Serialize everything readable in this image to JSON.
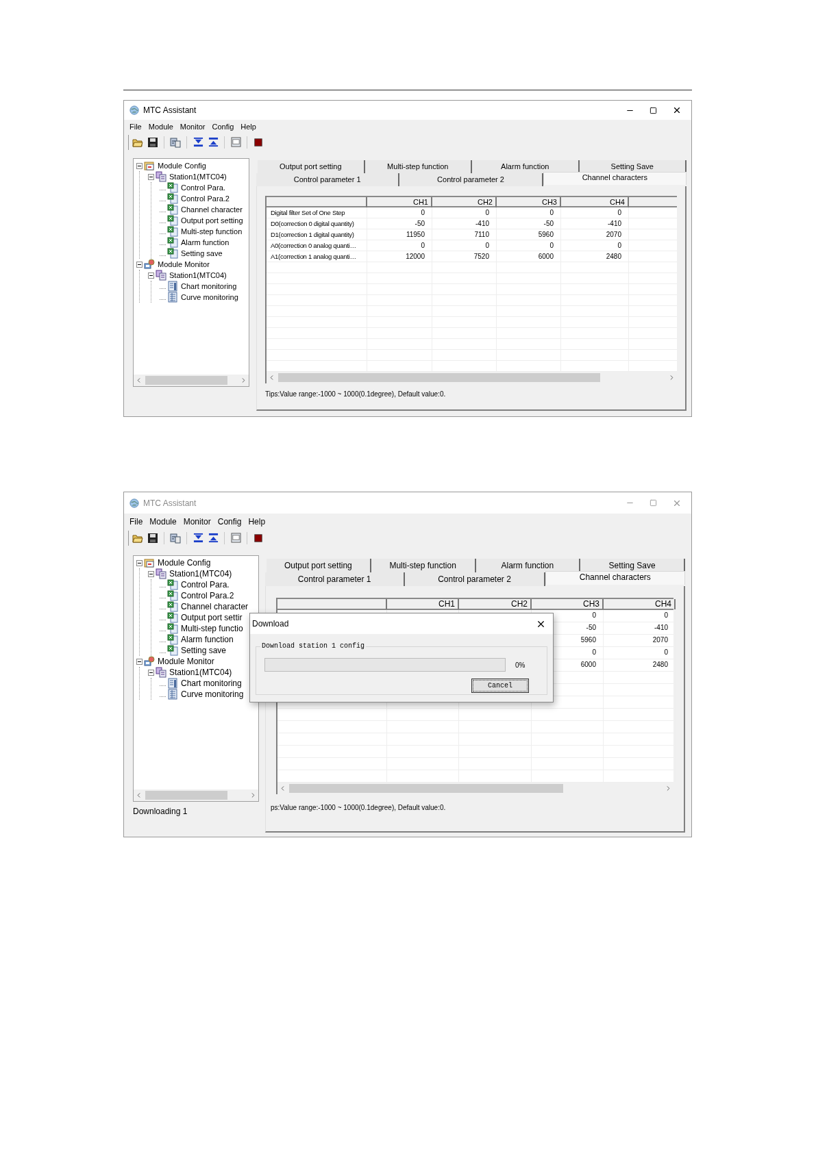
{
  "windows": [
    {
      "title": "MTC Assistant",
      "active": true,
      "menu": [
        "File",
        "Module",
        "Monitor",
        "Config",
        "Help"
      ],
      "tree": [
        {
          "label": "Module Config",
          "kind": "config",
          "expanded": true,
          "children": [
            {
              "label": "Station1(MTC04)",
              "kind": "station",
              "expanded": true,
              "children": [
                {
                  "label": "Control Para.",
                  "kind": "sheet"
                },
                {
                  "label": "Control Para.2",
                  "kind": "sheet"
                },
                {
                  "label": "Channel character",
                  "kind": "sheet"
                },
                {
                  "label": "Output port setting",
                  "kind": "sheet"
                },
                {
                  "label": "Multi-step function",
                  "kind": "sheet"
                },
                {
                  "label": "Alarm function",
                  "kind": "sheet"
                },
                {
                  "label": "Setting save",
                  "kind": "sheet"
                }
              ]
            }
          ]
        },
        {
          "label": "Module Monitor",
          "kind": "monitor",
          "expanded": true,
          "children": [
            {
              "label": "Station1(MTC04)",
              "kind": "station",
              "expanded": true,
              "children": [
                {
                  "label": "Chart monitoring",
                  "kind": "chart"
                },
                {
                  "label": "Curve monitoring",
                  "kind": "curve"
                }
              ]
            }
          ]
        }
      ],
      "tab_rows": [
        {
          "tabs": [
            {
              "label": "Output port setting",
              "selected": false
            },
            {
              "label": "Multi-step function",
              "selected": false
            },
            {
              "label": "Alarm function",
              "selected": false
            },
            {
              "label": "Setting Save",
              "selected": false
            }
          ]
        },
        {
          "tabs": [
            {
              "label": "Control parameter 1",
              "selected": false
            },
            {
              "label": "Control parameter 2",
              "selected": false
            },
            {
              "label": "Channel characters",
              "selected": true
            }
          ]
        }
      ],
      "table": {
        "columns": [
          "CH1",
          "CH2",
          "CH3",
          "CH4"
        ],
        "rows": [
          {
            "label": "Digital filter Set of One Step",
            "ch1": "0",
            "ch2": "0",
            "ch3": "0",
            "ch4": "0"
          },
          {
            "label": "D0(correction 0 digital quantity)",
            "ch1": "-50",
            "ch2": "-410",
            "ch3": "-50",
            "ch4": "-410"
          },
          {
            "label": "D1(correction 1 digital quantity)",
            "ch1": "11950",
            "ch2": "7110",
            "ch3": "5960",
            "ch4": "2070"
          },
          {
            "label": "A0(correction 0 analog quanti…",
            "ch1": "0",
            "ch2": "0",
            "ch3": "0",
            "ch4": "0"
          },
          {
            "label": "A1(correction 1 analog quanti…",
            "ch1": "12000",
            "ch2": "7520",
            "ch3": "6000",
            "ch4": "2480"
          }
        ]
      },
      "tips": "Tips:Value range:-1000 ~ 1000(0.1degree), Default value:0."
    },
    {
      "title": "MTC Assistant",
      "active": false,
      "menu": [
        "File",
        "Module",
        "Monitor",
        "Config",
        "Help"
      ],
      "tree": [
        {
          "label": "Module Config",
          "kind": "config",
          "expanded": true,
          "children": [
            {
              "label": "Station1(MTC04)",
              "kind": "station",
              "expanded": true,
              "children": [
                {
                  "label": "Control Para.",
                  "kind": "sheet"
                },
                {
                  "label": "Control Para.2",
                  "kind": "sheet"
                },
                {
                  "label": "Channel character",
                  "kind": "sheet"
                },
                {
                  "label": "Output port settir",
                  "kind": "sheet"
                },
                {
                  "label": "Multi-step functio",
                  "kind": "sheet"
                },
                {
                  "label": "Alarm function",
                  "kind": "sheet"
                },
                {
                  "label": "Setting save",
                  "kind": "sheet"
                }
              ]
            }
          ]
        },
        {
          "label": "Module Monitor",
          "kind": "monitor",
          "expanded": true,
          "children": [
            {
              "label": "Station1(MTC04)",
              "kind": "station",
              "expanded": true,
              "children": [
                {
                  "label": "Chart monitoring",
                  "kind": "chart"
                },
                {
                  "label": "Curve monitoring",
                  "kind": "curve"
                }
              ]
            }
          ]
        }
      ],
      "status": "Downloading 1",
      "tab_rows": [
        {
          "tabs": [
            {
              "label": "Output port setting",
              "selected": false
            },
            {
              "label": "Multi-step function",
              "selected": false
            },
            {
              "label": "Alarm function",
              "selected": false
            },
            {
              "label": "Setting Save",
              "selected": false
            }
          ]
        },
        {
          "tabs": [
            {
              "label": "Control parameter 1",
              "selected": false
            },
            {
              "label": "Control parameter 2",
              "selected": false
            },
            {
              "label": "Channel characters",
              "selected": true
            }
          ]
        }
      ],
      "table": {
        "columns": [
          "CH1",
          "CH2",
          "CH3",
          "CH4"
        ],
        "rows": [
          {
            "ch3": "0",
            "ch4": "0"
          },
          {
            "ch3": "-50",
            "ch4": "-410"
          },
          {
            "ch3": "5960",
            "ch4": "2070"
          },
          {
            "ch3": "0",
            "ch4": "0"
          },
          {
            "ch3": "6000",
            "ch4": "2480"
          }
        ]
      },
      "tips": "ps:Value range:-1000 ~ 1000(0.1degree), Default value:0.",
      "dialog": {
        "title": "Download",
        "group": "Download station 1 config",
        "level": 0,
        "reading": "0%",
        "button": "Cancel"
      }
    }
  ]
}
